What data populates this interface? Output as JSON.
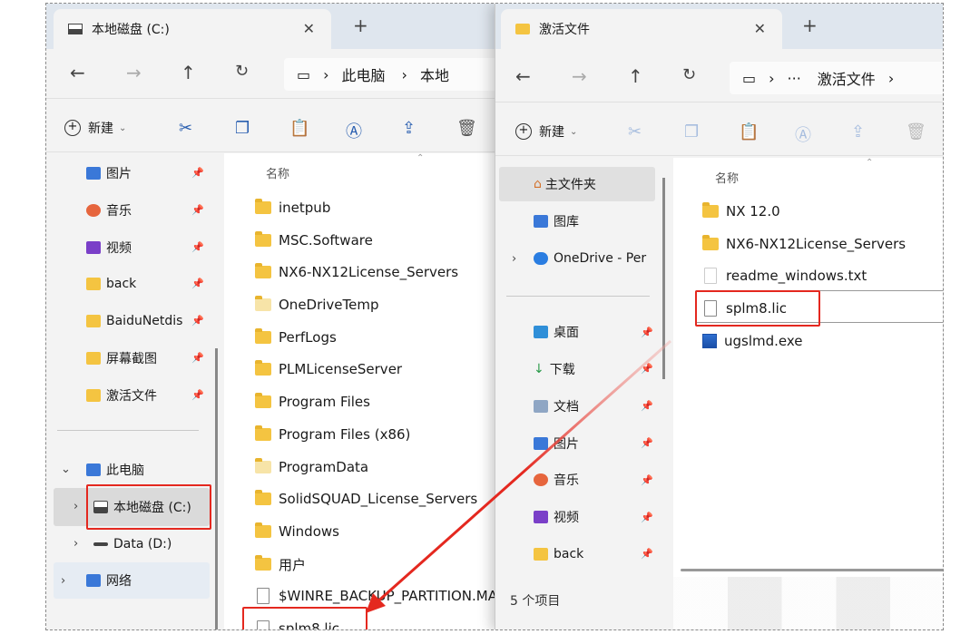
{
  "left_window": {
    "tab_title": "本地磁盘 (C:)",
    "breadcrumb": [
      "此电脑",
      "本地"
    ],
    "toolbar": {
      "new_label": "新建"
    },
    "sidebar_pinned": [
      {
        "label": "图片",
        "icon": "pictures-icon"
      },
      {
        "label": "音乐",
        "icon": "music-icon"
      },
      {
        "label": "视频",
        "icon": "video-icon"
      },
      {
        "label": "back",
        "icon": "folder-icon"
      },
      {
        "label": "BaiduNetdis",
        "icon": "folder-icon"
      },
      {
        "label": "屏幕截图",
        "icon": "folder-icon"
      },
      {
        "label": "激活文件",
        "icon": "folder-icon"
      }
    ],
    "sidebar_tree": {
      "this_pc": "此电脑",
      "local_disk": "本地磁盘 (C:)",
      "data_disk": "Data (D:)",
      "network": "网络"
    },
    "column_name": "名称",
    "files": [
      {
        "name": "inetpub",
        "type": "folder"
      },
      {
        "name": "MSC.Software",
        "type": "folder"
      },
      {
        "name": "NX6-NX12License_Servers",
        "type": "folder"
      },
      {
        "name": "OneDriveTemp",
        "type": "folder"
      },
      {
        "name": "PerfLogs",
        "type": "folder"
      },
      {
        "name": "PLMLicenseServer",
        "type": "folder"
      },
      {
        "name": "Program Files",
        "type": "folder"
      },
      {
        "name": "Program Files (x86)",
        "type": "folder"
      },
      {
        "name": "ProgramData",
        "type": "folder"
      },
      {
        "name": "SolidSQUAD_License_Servers",
        "type": "folder"
      },
      {
        "name": "Windows",
        "type": "folder"
      },
      {
        "name": "用户",
        "type": "folder"
      },
      {
        "name": "$WINRE_BACKUP_PARTITION.MA",
        "type": "file"
      },
      {
        "name": "splm8.lic",
        "type": "file"
      }
    ]
  },
  "right_window": {
    "tab_title": "激活文件",
    "breadcrumb": [
      "···",
      "激活文件"
    ],
    "toolbar": {
      "new_label": "新建"
    },
    "sidebar": [
      {
        "label": "主文件夹",
        "icon": "home-icon"
      },
      {
        "label": "图库",
        "icon": "gallery-icon"
      },
      {
        "label": "OneDrive - Per",
        "icon": "cloud-icon"
      }
    ],
    "sidebar_pinned": [
      {
        "label": "桌面",
        "icon": "desktop-icon"
      },
      {
        "label": "下载",
        "icon": "download-icon"
      },
      {
        "label": "文档",
        "icon": "document-icon"
      },
      {
        "label": "图片",
        "icon": "pictures-icon"
      },
      {
        "label": "音乐",
        "icon": "music-icon"
      },
      {
        "label": "视频",
        "icon": "video-icon"
      },
      {
        "label": "back",
        "icon": "folder-icon"
      }
    ],
    "column_name": "名称",
    "files": [
      {
        "name": "NX 12.0",
        "type": "folder"
      },
      {
        "name": "NX6-NX12License_Servers",
        "type": "folder"
      },
      {
        "name": "readme_windows.txt",
        "type": "file"
      },
      {
        "name": "splm8.lic",
        "type": "file"
      },
      {
        "name": "ugslmd.exe",
        "type": "exe"
      }
    ],
    "status": "5 个项目"
  },
  "colors": {
    "highlight_red": "#e4281f",
    "folder_yellow": "#f4c441",
    "accent_blue": "#2a5fb0"
  }
}
